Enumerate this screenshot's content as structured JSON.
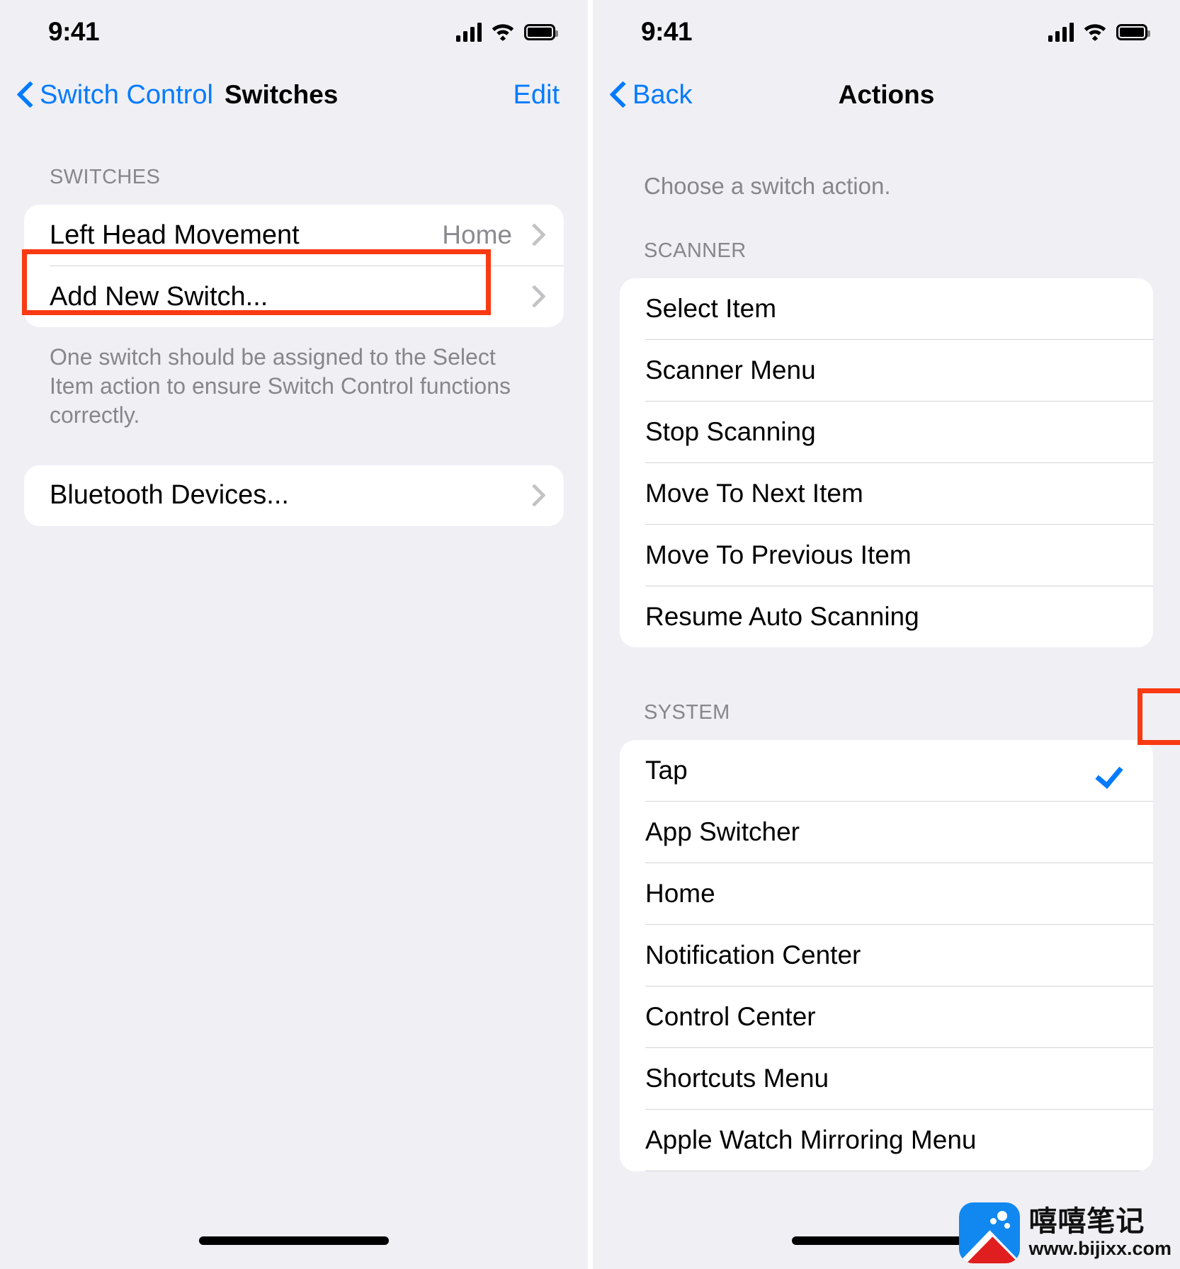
{
  "left_screen": {
    "status_bar": {
      "time": "9:41",
      "cellular_icon": "cellular-signal-icon",
      "wifi_icon": "wifi-icon",
      "battery_icon": "battery-icon"
    },
    "nav": {
      "back_label": "Switch Control",
      "title": "Switches",
      "edit_label": "Edit"
    },
    "section_header": "SWITCHES",
    "rows": [
      {
        "label": "Left Head Movement",
        "value": "Home",
        "accessory": "chevron-right-icon"
      },
      {
        "label": "Add New Switch...",
        "value": "",
        "accessory": "chevron-right-icon"
      }
    ],
    "footnote": "One switch should be assigned to the Select Item action to ensure Switch Control functions correctly.",
    "bluetooth_row": {
      "label": "Bluetooth Devices...",
      "accessory": "chevron-right-icon"
    },
    "highlight_target": "Add New Switch..."
  },
  "right_screen": {
    "status_bar": {
      "time": "9:41",
      "cellular_icon": "cellular-signal-icon",
      "wifi_icon": "wifi-icon",
      "battery_icon": "battery-icon"
    },
    "nav": {
      "back_label": "Back",
      "title": "Actions"
    },
    "intro": "Choose a switch action.",
    "sections": [
      {
        "header": "SCANNER",
        "items": [
          {
            "label": "Select Item",
            "selected": false
          },
          {
            "label": "Scanner Menu",
            "selected": false
          },
          {
            "label": "Stop Scanning",
            "selected": false
          },
          {
            "label": "Move To Next Item",
            "selected": false
          },
          {
            "label": "Move To Previous Item",
            "selected": false
          },
          {
            "label": "Resume Auto Scanning",
            "selected": false
          }
        ]
      },
      {
        "header": "SYSTEM",
        "items": [
          {
            "label": "Tap",
            "selected": true
          },
          {
            "label": "App Switcher",
            "selected": false
          },
          {
            "label": "Home",
            "selected": false
          },
          {
            "label": "Notification Center",
            "selected": false
          },
          {
            "label": "Control Center",
            "selected": false
          },
          {
            "label": "Shortcuts Menu",
            "selected": false
          },
          {
            "label": "Apple Watch Mirroring Menu",
            "selected": false
          }
        ]
      }
    ],
    "highlight_target": "Tap",
    "checkmark_icon": "checkmark-icon"
  },
  "watermark": {
    "brand_cn": "嘻嘻笔记",
    "url": "www.bijixx.com",
    "logo_icon": "mountain-logo-icon"
  },
  "colors": {
    "accent_blue": "#037bff",
    "highlight_red": "#f93a13",
    "page_background": "#f0eff4",
    "card_background": "#ffffff",
    "secondary_text": "#86868b"
  }
}
